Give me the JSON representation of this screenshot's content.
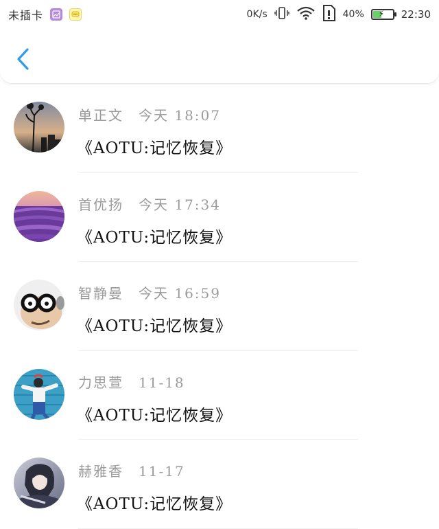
{
  "status_bar": {
    "carrier": "未插卡",
    "speed": "0K/s",
    "battery_percent": "40%",
    "battery_level": 0.4,
    "time": "22:30",
    "icons": [
      "gallery-app-icon",
      "message-app-icon",
      "vibrate-icon",
      "wifi-icon",
      "sim-alert-icon",
      "battery-charging-icon"
    ]
  },
  "header": {
    "back_icon": "chevron-left-icon",
    "accent": "#2f9bea"
  },
  "messages": [
    {
      "name": "单正文",
      "time": "今天 18:07",
      "title": "《AOTU:记忆恢复》",
      "avatar": "sunset-silhouette"
    },
    {
      "name": "首优扬",
      "time": "今天 17:34",
      "title": "《AOTU:记忆恢复》",
      "avatar": "lavender-field"
    },
    {
      "name": "智静曼",
      "time": "今天 16:59",
      "title": "《AOTU:记忆恢复》",
      "avatar": "glasses-character"
    },
    {
      "name": "力思萱",
      "time": "11-18",
      "title": "《AOTU:记忆恢复》",
      "avatar": "girl-blue-wall"
    },
    {
      "name": "赫雅香",
      "time": "11-17",
      "title": "《AOTU:记忆恢复》",
      "avatar": "anime-character"
    }
  ]
}
